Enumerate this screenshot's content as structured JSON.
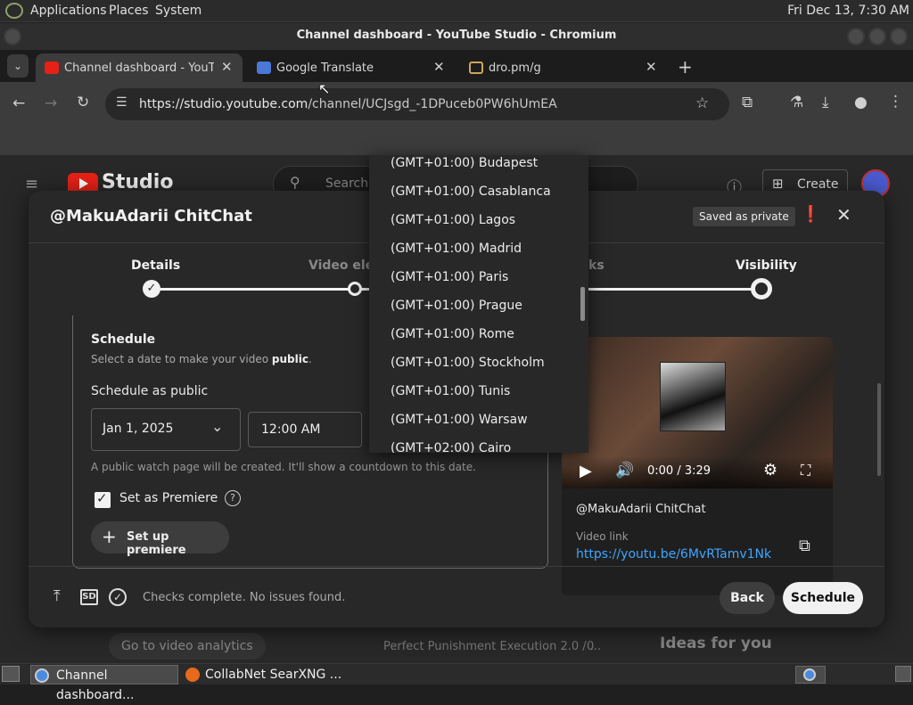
{
  "panel": {
    "menus": [
      "Applications",
      "Places",
      "System"
    ],
    "clock": "Fri Dec 13,  7:30 AM"
  },
  "window": {
    "title": "Channel dashboard - YouTube Studio - Chromium"
  },
  "tabs": [
    {
      "title": "Channel dashboard - YouTube Studio",
      "favicon": "youtube-favicon",
      "active": true
    },
    {
      "title": "Google Translate",
      "favicon": "translate-favicon",
      "active": false
    },
    {
      "title": "dro.pm/g",
      "favicon": "folder-favicon",
      "active": false
    }
  ],
  "omnibox": {
    "url_host": "https://studio.youtube.com",
    "url_path": "/channel/UCJsgd_-1DPuceb0PW6hUmEA"
  },
  "studio": {
    "brand": "Studio",
    "search_placeholder": "Search",
    "create_label": "Create",
    "bottom_left": "Go to video analytics",
    "bottom_mid": "Perfect Punishment Execution 2.0 / ...",
    "bottom_count": "0",
    "bottom_right": "Ideas for you"
  },
  "modal": {
    "title": "@MakuAdarii ChitChat",
    "saved_badge": "Saved as private",
    "steps": [
      "Details",
      "Video elements",
      "Checks",
      "Visibility"
    ],
    "schedule": {
      "heading": "Schedule",
      "desc_prefix": "Select a date to make your video ",
      "desc_bold": "public",
      "desc_suffix": ".",
      "schedule_as": "Schedule as public",
      "date": "Jan 1, 2025",
      "time": "12:00 AM",
      "note": "A public watch page will be created. It'll show a countdown to this date.",
      "premiere_label": "Set as Premiere",
      "premiere_checked": true,
      "setup_label": "Set up premiere"
    },
    "video": {
      "time": "0:00 / 3:29",
      "channel": "@MakuAdarii ChitChat",
      "link_label": "Video link",
      "link": "https://youtu.be/6MvRTamv1Nk"
    },
    "footer": {
      "status": "Checks complete. No issues found.",
      "quality": "SD",
      "back": "Back",
      "schedule": "Schedule"
    }
  },
  "timezones": [
    "(GMT+01:00) Budapest",
    "(GMT+01:00) Casablanca",
    "(GMT+01:00) Lagos",
    "(GMT+01:00) Madrid",
    "(GMT+01:00) Paris",
    "(GMT+01:00) Prague",
    "(GMT+01:00) Rome",
    "(GMT+01:00) Stockholm",
    "(GMT+01:00) Tunis",
    "(GMT+01:00) Warsaw",
    "(GMT+02:00) Cairo"
  ],
  "taskbar": [
    {
      "title": "Channel dashboard...",
      "icon": "chromium-icon",
      "active": true
    },
    {
      "title": "CollabNet SearXNG ...",
      "icon": "firefox-icon",
      "active": false
    }
  ]
}
